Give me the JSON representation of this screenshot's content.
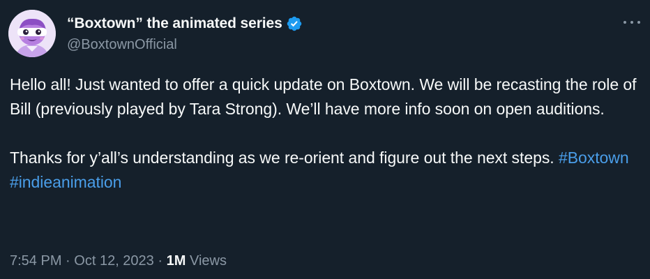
{
  "tweet": {
    "display_name": "“Boxtown” the animated series",
    "handle": "@BoxtownOfficial",
    "verified": true,
    "body": {
      "para1": "Hello all! Just wanted to offer a quick update on Boxtown. We will be recasting the role of Bill (previously played by Tara Strong). We’ll have more info soon on open auditions.",
      "para2_text": "Thanks for y’all’s understanding as we re-orient and figure out the next steps.",
      "hashtags": [
        "#Boxtown",
        "#indieanimation"
      ]
    },
    "time": "7:54 PM",
    "separator": "·",
    "date": "Oct 12, 2023",
    "views_count": "1M",
    "views_label": "Views"
  },
  "colors": {
    "background": "#15202b",
    "text": "#f7f9f9",
    "secondary": "#8b98a5",
    "link": "#4a9ee9",
    "verified": "#1d9bf0"
  },
  "icons": {
    "verified": "verified-badge-icon",
    "more": "more-horizontal-icon"
  }
}
